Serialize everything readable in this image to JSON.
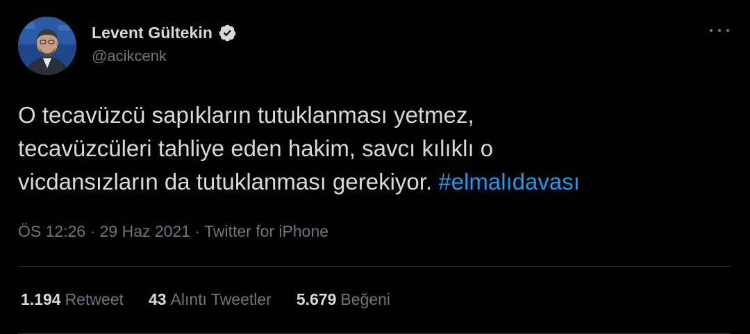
{
  "author": {
    "display_name": "Levent Gültekin",
    "handle": "@acikcenk",
    "verified": true,
    "avatar_icon": "profile-photo"
  },
  "tweet": {
    "lines": [
      "O tecavüzcü sapıkların tutuklanması yetmez,",
      "tecavüzcüleri tahliye eden hakim, savcı kılıklı o",
      "vicdansızların da tutuklanması gerekiyor."
    ],
    "hashtag": "#elmalıdavası"
  },
  "meta": {
    "text": "ÖS 12:26 · 29 Haz 2021 · Twitter for iPhone"
  },
  "stats": [
    {
      "count": "1.194",
      "label": "Retweet"
    },
    {
      "count": "43",
      "label": "Alıntı Tweetler"
    },
    {
      "count": "5.679",
      "label": "Beğeni"
    }
  ],
  "colors": {
    "background": "#000000",
    "text": "#d9d9d9",
    "secondary": "#6e767d",
    "link": "#1d9bf0",
    "divider": "#2f3336"
  }
}
